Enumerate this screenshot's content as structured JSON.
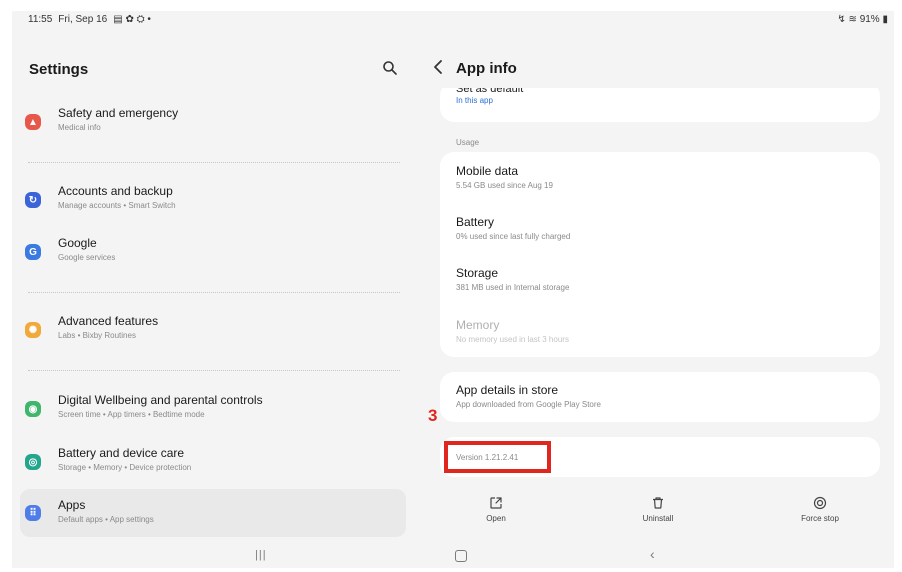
{
  "statusbar": {
    "time": "11:55",
    "date": "Fri, Sep 16",
    "battery": "91%"
  },
  "settings_panel": {
    "title": "Settings",
    "items": [
      {
        "title": "Safety and emergency",
        "subtitle": "Medical info",
        "icon": "siren-icon",
        "color": "#e8584a"
      },
      {
        "title": "Accounts and backup",
        "subtitle": "Manage accounts • Smart Switch",
        "icon": "sync-icon",
        "color": "#3b64d8"
      },
      {
        "title": "Google",
        "subtitle": "Google services",
        "icon": "google-icon",
        "color": "#3b7ae0"
      },
      {
        "title": "Advanced features",
        "subtitle": "Labs • Bixby Routines",
        "icon": "gear-star-icon",
        "color": "#f0a93a"
      },
      {
        "title": "Digital Wellbeing and parental controls",
        "subtitle": "Screen time • App timers • Bedtime mode",
        "icon": "wellbeing-icon",
        "color": "#3fb66b"
      },
      {
        "title": "Battery and device care",
        "subtitle": "Storage • Memory • Device protection",
        "icon": "device-care-icon",
        "color": "#24a58d"
      },
      {
        "title": "Apps",
        "subtitle": "Default apps • App settings",
        "icon": "apps-grid-icon",
        "color": "#4f7de8",
        "selected": true
      }
    ]
  },
  "app_info": {
    "title": "App info",
    "set_default": {
      "title": "Set as default",
      "value": "In this app"
    },
    "usage_label": "Usage",
    "usage": [
      {
        "title": "Mobile data",
        "subtitle": "5.54 GB used since Aug 19"
      },
      {
        "title": "Battery",
        "subtitle": "0% used since last fully charged"
      },
      {
        "title": "Storage",
        "subtitle": "381 MB used in Internal storage"
      },
      {
        "title": "Memory",
        "subtitle": "No memory used in last 3 hours",
        "disabled": true
      }
    ],
    "store": {
      "title": "App details in store",
      "subtitle": "App downloaded from Google Play Store"
    },
    "version": "Version 1.21.2.41",
    "actions": [
      {
        "label": "Open",
        "icon": "open-external-icon"
      },
      {
        "label": "Uninstall",
        "icon": "trash-icon"
      },
      {
        "label": "Force stop",
        "icon": "stop-icon"
      }
    ]
  },
  "annotation": {
    "number": "3",
    "color": "#e0261e"
  }
}
